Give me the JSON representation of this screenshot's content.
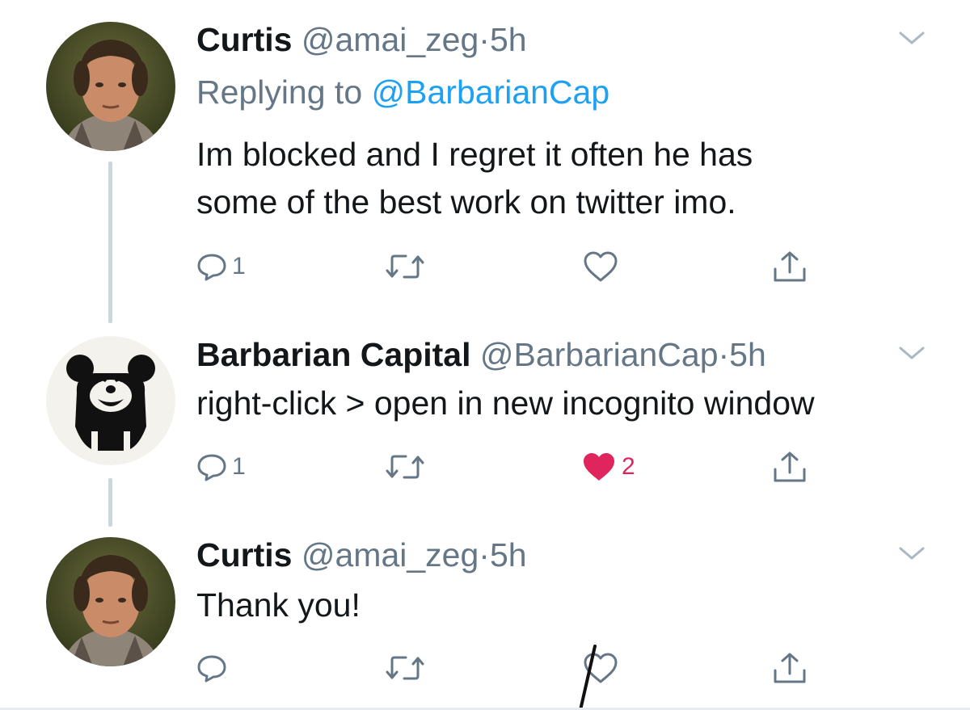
{
  "thread": [
    {
      "author_name": "Curtis",
      "author_handle": "@amai_zeg",
      "separator": "·",
      "time": "5h",
      "replying_prefix": "Replying to",
      "replying_handle": "@BarbarianCap",
      "text_lines": [
        "Im blocked and I regret it often he has",
        "some of the best work on twitter imo."
      ],
      "reply_count": "1",
      "retweet_count": "",
      "like_count": "",
      "liked": false,
      "avatar": "man-portrait-avatar"
    },
    {
      "author_name": "Barbarian Capital",
      "author_handle": "@BarbarianCap",
      "separator": "·",
      "time": "5h",
      "text_lines": [
        "right-click > open in new incognito window"
      ],
      "reply_count": "1",
      "retweet_count": "",
      "like_count": "2",
      "liked": true,
      "avatar": "cartoon-mouse-panda-avatar"
    },
    {
      "author_name": "Curtis",
      "author_handle": "@amai_zeg",
      "separator": "·",
      "time": "5h",
      "text_lines": [
        "Thank you!"
      ],
      "reply_count": "",
      "retweet_count": "",
      "like_count": "",
      "liked": false,
      "avatar": "man-portrait-avatar"
    }
  ],
  "colors": {
    "text": "#14171a",
    "secondary": "#657786",
    "link": "#1da1f2",
    "like": "#e0245e",
    "thread_line": "#ccd6dd"
  },
  "icons": [
    "reply-icon",
    "retweet-icon",
    "like-icon",
    "share-icon",
    "chevron-down-icon"
  ]
}
